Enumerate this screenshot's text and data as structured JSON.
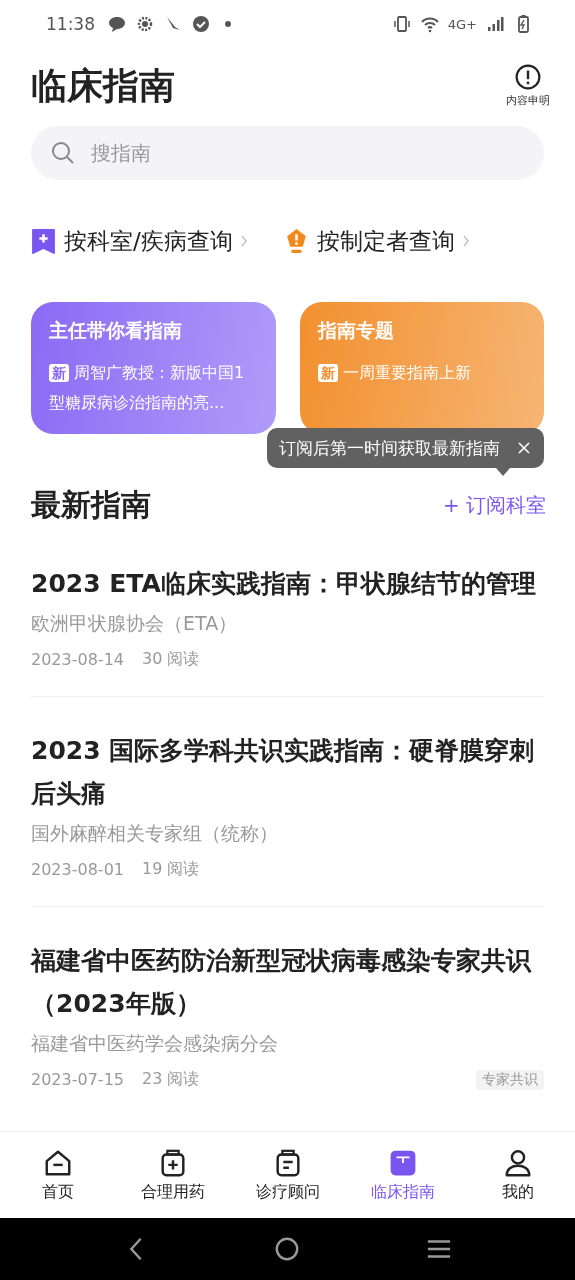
{
  "status_bar": {
    "time": "11:38",
    "network": "4G+"
  },
  "header": {
    "title": "临床指南",
    "notice_label": "内容申明"
  },
  "search": {
    "placeholder": "搜指南"
  },
  "quick_links": [
    {
      "label": "按科室/疾病查询",
      "kind": "department"
    },
    {
      "label": "按制定者查询",
      "kind": "maker"
    }
  ],
  "feature_cards": [
    {
      "title": "主任带你看指南",
      "badge": "新",
      "text": "周智广教授：新版中国1型糖尿病诊治指南的亮...",
      "color": "#8a6af5"
    },
    {
      "title": "指南专题",
      "badge": "新",
      "text": "一周重要指南上新",
      "color": "#f2902e"
    }
  ],
  "tooltip": {
    "text": "订阅后第一时间获取最新指南"
  },
  "section": {
    "title": "最新指南",
    "action": "+ 订阅科室"
  },
  "guidelines": [
    {
      "title": "2023 ETA临床实践指南：甲状腺结节的管理",
      "source": "欧洲甲状腺协会（ETA）",
      "date": "2023-08-14",
      "reads": "30 阅读"
    },
    {
      "title": "2023 国际多学科共识实践指南：硬脊膜穿刺后头痛",
      "source": "国外麻醉相关专家组（统称）",
      "date": "2023-08-01",
      "reads": "19 阅读"
    },
    {
      "title": "福建省中医药防治新型冠状病毒感染专家共识（2023年版）",
      "source": "福建省中医药学会感染病分会",
      "date": "2023-07-15",
      "reads": "23 阅读",
      "tag": "专家共识"
    }
  ],
  "tabs": [
    {
      "label": "首页",
      "kind": "home",
      "selected": false
    },
    {
      "label": "合理用药",
      "kind": "medicine",
      "selected": false
    },
    {
      "label": "诊疗顾问",
      "kind": "consult",
      "selected": false
    },
    {
      "label": "临床指南",
      "kind": "guide",
      "selected": true
    },
    {
      "label": "我的",
      "kind": "user",
      "selected": false
    }
  ]
}
